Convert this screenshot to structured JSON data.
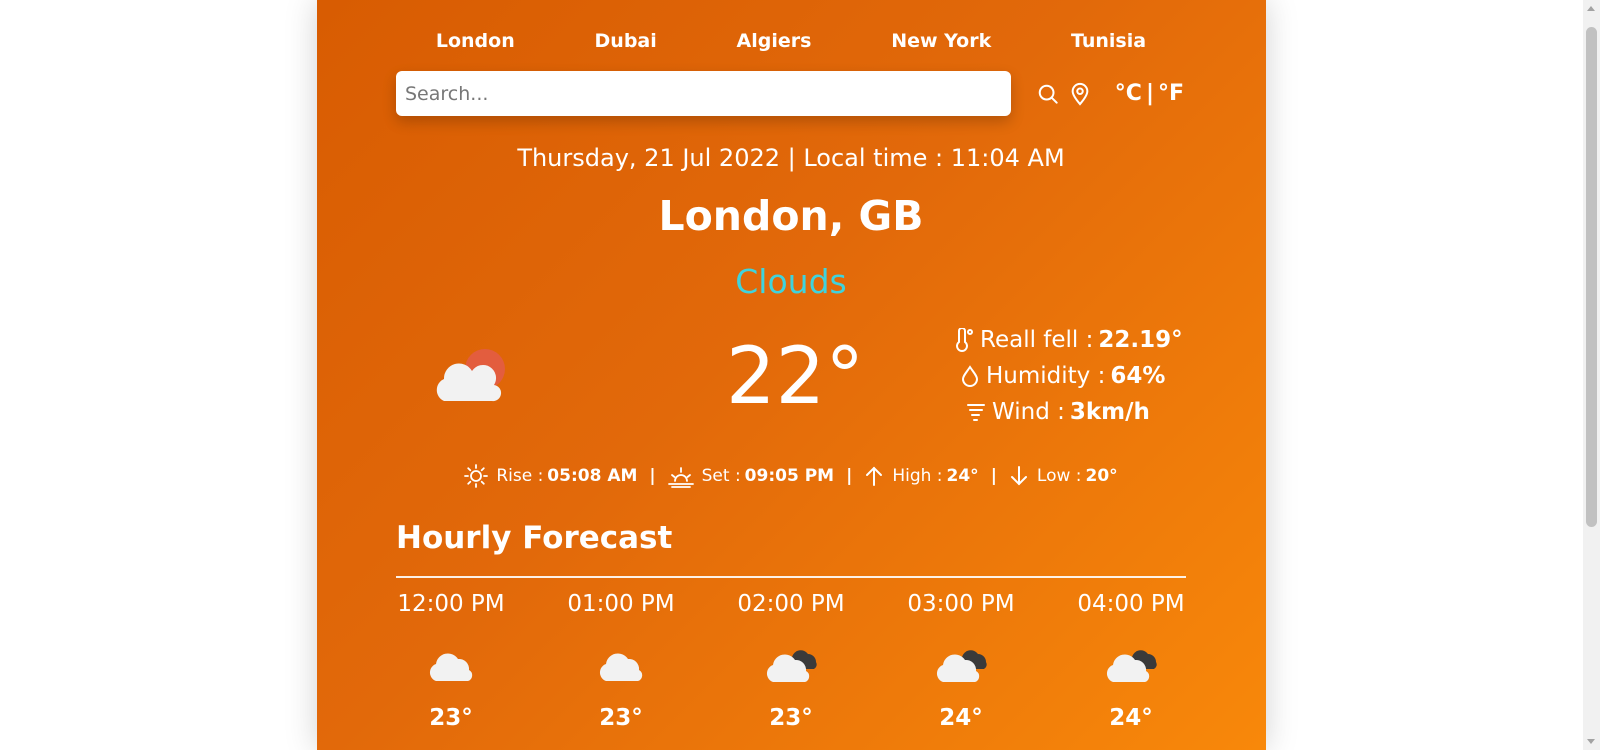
{
  "nav": {
    "cities": [
      "London",
      "Dubai",
      "Algiers",
      "New York",
      "Tunisia"
    ]
  },
  "search": {
    "placeholder": "Search...",
    "value": ""
  },
  "units": {
    "celsius": "°C",
    "separator": "|",
    "fahrenheit": "°F"
  },
  "header": {
    "datetime": "Thursday, 21 Jul 2022 | Local time : 11:04 AM",
    "location": "London, GB",
    "condition": "Clouds"
  },
  "current": {
    "temperature": "22°",
    "icon": "cloud-with-sun-icon",
    "real_feel_label": "Reall fell :",
    "real_feel_value": "22.19°",
    "humidity_label": "Humidity :",
    "humidity_value": "64%",
    "wind_label": "Wind :",
    "wind_value": "3km/h"
  },
  "sun": {
    "rise_label": "Rise :",
    "rise_value": "05:08 AM",
    "set_label": "Set :",
    "set_value": "09:05 PM",
    "high_label": "High :",
    "high_value": "24°",
    "low_label": "Low :",
    "low_value": "20°",
    "separator": "|"
  },
  "forecast": {
    "title": "Hourly Forecast",
    "hours": [
      {
        "time": "12:00 PM",
        "temp": "23°",
        "icon": "cloud-icon"
      },
      {
        "time": "01:00 PM",
        "temp": "23°",
        "icon": "cloud-icon"
      },
      {
        "time": "02:00 PM",
        "temp": "23°",
        "icon": "broken-clouds-icon"
      },
      {
        "time": "03:00 PM",
        "temp": "24°",
        "icon": "broken-clouds-icon"
      },
      {
        "time": "04:00 PM",
        "temp": "24°",
        "icon": "broken-clouds-icon"
      }
    ]
  },
  "colors": {
    "gradient_start": "#d85c02",
    "gradient_end": "#f8880a",
    "condition_text": "#3fd3dd",
    "text": "#ffffff"
  }
}
